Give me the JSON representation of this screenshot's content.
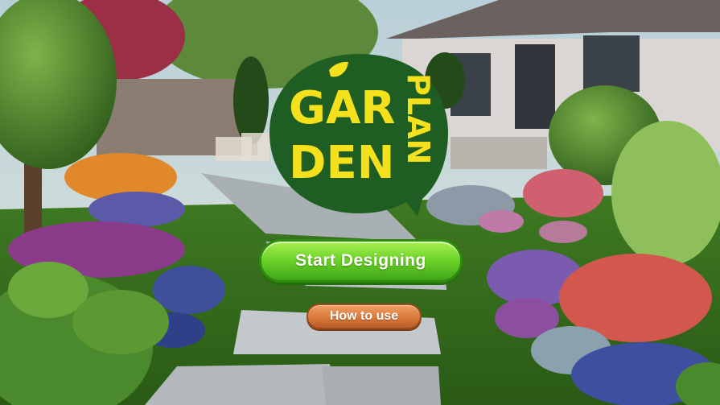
{
  "logo": {
    "line1": "GAR",
    "line2": "DEN",
    "side": "PLAN"
  },
  "buttons": {
    "start": "Start Designing",
    "how_to_use": "How to use"
  },
  "colors": {
    "logo_bubble": "#1f5e22",
    "logo_text": "#f4e01c",
    "start_button": "#6fd62a",
    "how_button": "#d97a3c"
  }
}
